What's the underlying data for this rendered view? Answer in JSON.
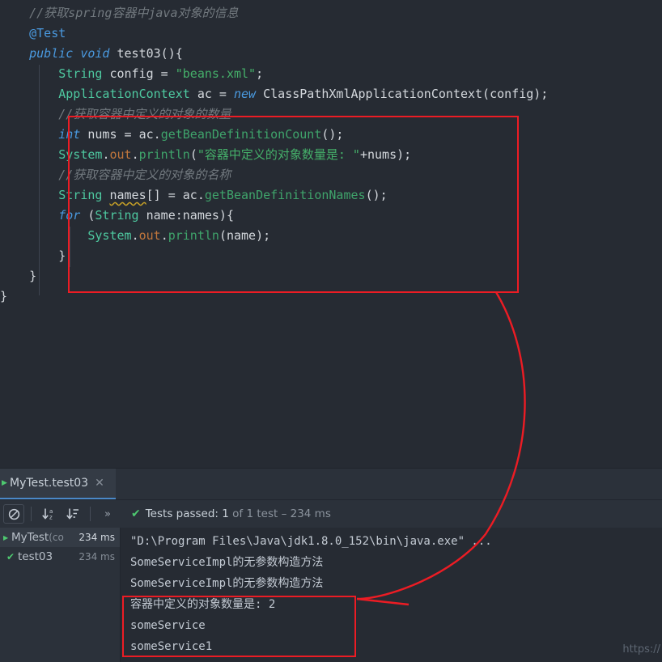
{
  "editor": {
    "lines": [
      [
        {
          "t": "    ",
          "c": "plain"
        },
        {
          "t": "//获取spring容器中java对象的信息",
          "c": "cmt"
        }
      ],
      [
        {
          "t": "    ",
          "c": "plain"
        },
        {
          "t": "@Test",
          "c": "ann"
        }
      ],
      [
        {
          "t": "    ",
          "c": "plain"
        },
        {
          "t": "public void ",
          "c": "kw"
        },
        {
          "t": "test03(){",
          "c": "plain"
        }
      ],
      [
        {
          "t": "        ",
          "c": "plain"
        },
        {
          "t": "String",
          "c": "typ"
        },
        {
          "t": " config = ",
          "c": "plain"
        },
        {
          "t": "\"beans.xml\"",
          "c": "str"
        },
        {
          "t": ";",
          "c": "plain"
        }
      ],
      [
        {
          "t": "        ",
          "c": "plain"
        },
        {
          "t": "ApplicationContext",
          "c": "typ"
        },
        {
          "t": " ac = ",
          "c": "plain"
        },
        {
          "t": "new",
          "c": "kw"
        },
        {
          "t": " ClassPathXmlApplicationContext(config);",
          "c": "plain"
        }
      ],
      [
        {
          "t": "        ",
          "c": "plain"
        },
        {
          "t": "//获取容器中定义的对象的数量",
          "c": "cmt"
        }
      ],
      [
        {
          "t": "        ",
          "c": "plain"
        },
        {
          "t": "int",
          "c": "kw"
        },
        {
          "t": " nums = ac.",
          "c": "plain"
        },
        {
          "t": "getBeanDefinitionCount",
          "c": "mth"
        },
        {
          "t": "();",
          "c": "plain"
        }
      ],
      [
        {
          "t": "        ",
          "c": "plain"
        },
        {
          "t": "System",
          "c": "typ"
        },
        {
          "t": ".",
          "c": "plain"
        },
        {
          "t": "out",
          "c": "fld"
        },
        {
          "t": ".",
          "c": "plain"
        },
        {
          "t": "println",
          "c": "mth"
        },
        {
          "t": "(",
          "c": "plain"
        },
        {
          "t": "\"容器中定义的对象数量是: \"",
          "c": "str"
        },
        {
          "t": "+nums);",
          "c": "plain"
        }
      ],
      [
        {
          "t": "        ",
          "c": "plain"
        },
        {
          "t": "//获取容器中定义的对象的名称",
          "c": "cmt"
        }
      ],
      [
        {
          "t": "        ",
          "c": "plain"
        },
        {
          "t": "String",
          "c": "typ"
        },
        {
          "t": " ",
          "c": "plain"
        },
        {
          "t": "names",
          "c": "warn"
        },
        {
          "t": "[] = ac.",
          "c": "plain"
        },
        {
          "t": "getBeanDefinitionNames",
          "c": "mth"
        },
        {
          "t": "();",
          "c": "plain"
        }
      ],
      [
        {
          "t": "        ",
          "c": "plain"
        },
        {
          "t": "for",
          "c": "kw"
        },
        {
          "t": " (",
          "c": "plain"
        },
        {
          "t": "String",
          "c": "typ"
        },
        {
          "t": " name:names){",
          "c": "plain"
        }
      ],
      [
        {
          "t": "            ",
          "c": "plain"
        },
        {
          "t": "System",
          "c": "typ"
        },
        {
          "t": ".",
          "c": "plain"
        },
        {
          "t": "out",
          "c": "fld"
        },
        {
          "t": ".",
          "c": "plain"
        },
        {
          "t": "println",
          "c": "mth"
        },
        {
          "t": "(name);",
          "c": "plain"
        }
      ],
      [
        {
          "t": "        ",
          "c": "plain"
        },
        {
          "t": "}",
          "c": "plain"
        }
      ],
      [
        {
          "t": "    ",
          "c": "plain"
        },
        {
          "t": "}",
          "c": "plain"
        }
      ],
      [
        {
          "t": "}",
          "c": "plain"
        }
      ]
    ]
  },
  "annotations": {
    "code_box_color": "#ec1c24",
    "output_box_color": "#ec1c24",
    "arrow_color": "#ec1c24"
  },
  "runner": {
    "tab": {
      "label": "MyTest.test03",
      "close_icon": "✕"
    },
    "toolbar": {
      "icons": [
        {
          "name": "suppress-icon",
          "glyph": "⊘"
        },
        {
          "name": "sort-alphabetically-icon",
          "glyph": "↓"
        },
        {
          "name": "sort-by-duration-icon",
          "glyph": "↓"
        },
        {
          "name": "expand-more-icon",
          "glyph": "»"
        }
      ],
      "sort_alpha_sub": "a\nz",
      "sort_dur_sub": "≡"
    },
    "status": {
      "check": "✔",
      "passed_label": "Tests passed: ",
      "passed_count": "1",
      "detail": " of 1 test – 234 ms"
    },
    "tree": [
      {
        "name": "MyTest",
        "sub": " (co",
        "duration": "234 ms",
        "selected": true,
        "icon": "caret",
        "dim": false
      },
      {
        "name": "test03",
        "sub": "",
        "duration": "234 ms",
        "selected": false,
        "icon": "check",
        "dim": true
      }
    ],
    "console_lines": [
      "\"D:\\Program Files\\Java\\jdk1.8.0_152\\bin\\java.exe\" ...",
      "SomeServiceImpl的无参数构造方法",
      "SomeServiceImpl的无参数构造方法",
      "容器中定义的对象数量是: 2",
      "someService",
      "someService1"
    ]
  },
  "watermark": {
    "text": "https://"
  }
}
